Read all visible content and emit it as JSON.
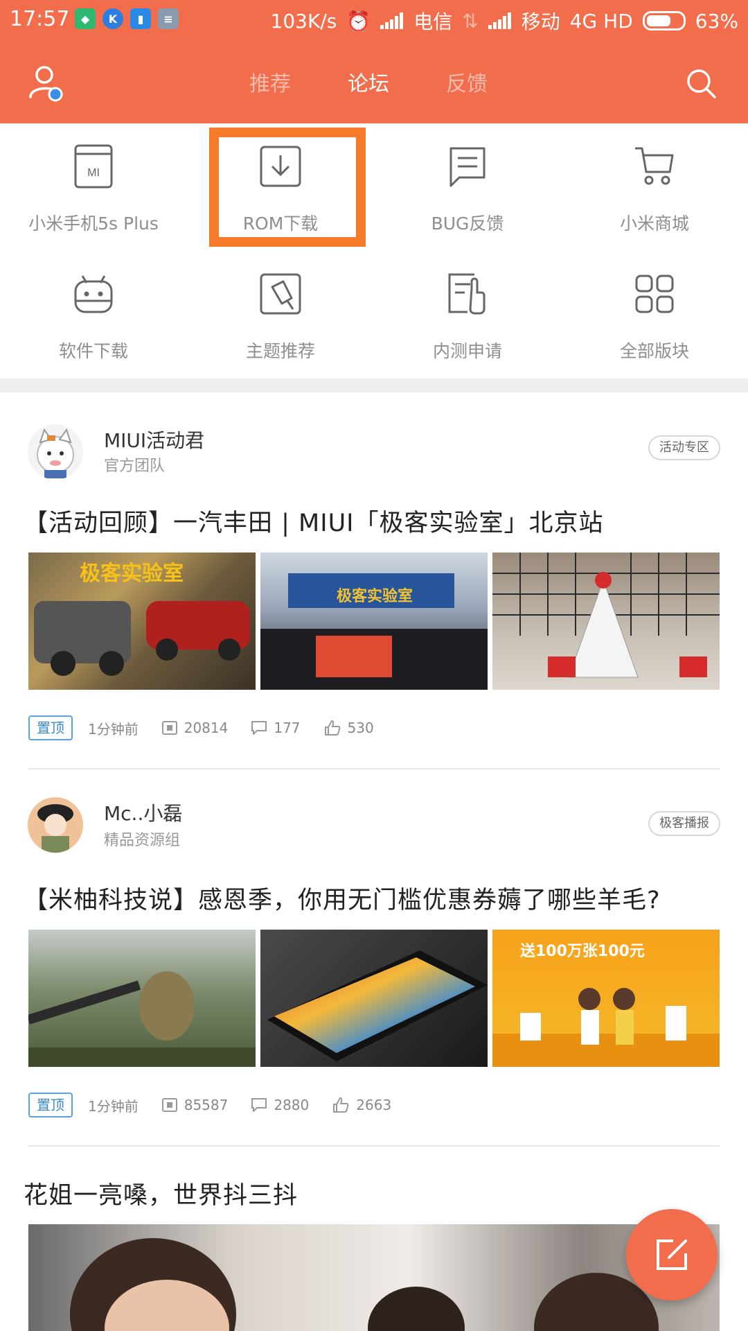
{
  "status_bar": {
    "time": "17:57",
    "speed": "103K/s",
    "carrier1": "电信",
    "carrier2": "移动",
    "network": "4G HD",
    "battery": "63%"
  },
  "nav": {
    "tabs": [
      {
        "label": "推荐",
        "active": false
      },
      {
        "label": "论坛",
        "active": true
      },
      {
        "label": "反馈",
        "active": false
      }
    ]
  },
  "shortcuts": [
    {
      "label": "小米手机5s Plus",
      "icon": "phone-icon"
    },
    {
      "label": "ROM下载",
      "icon": "download-icon"
    },
    {
      "label": "BUG反馈",
      "icon": "feedback-icon"
    },
    {
      "label": "小米商城",
      "icon": "cart-icon"
    },
    {
      "label": "软件下载",
      "icon": "android-icon"
    },
    {
      "label": "主题推荐",
      "icon": "theme-brush-icon"
    },
    {
      "label": "内测申请",
      "icon": "beta-apply-icon"
    },
    {
      "label": "全部版块",
      "icon": "all-sections-icon"
    }
  ],
  "posts": [
    {
      "author": "MIUI活动君",
      "group": "官方团队",
      "tag": "活动专区",
      "title": "【活动回顾】一汽丰田 | MIUI「极客实验室」北京站",
      "pin": "置顶",
      "time": "1分钟前",
      "views": "20814",
      "comments": "177",
      "likes": "530"
    },
    {
      "author": "Mc..小磊",
      "group": "精品资源组",
      "tag": "极客播报",
      "title": "【米柚科技说】感恩季，你用无门槛优惠券薅了哪些羊毛?",
      "pin": "置顶",
      "time": "1分钟前",
      "views": "85587",
      "comments": "2880",
      "likes": "2663"
    },
    {
      "title": "花姐一亮嗓，世界抖三抖"
    }
  ],
  "colors": {
    "brand": "#f26d4c",
    "highlight": "#f57b2a",
    "pin": "#3a8ad3"
  }
}
